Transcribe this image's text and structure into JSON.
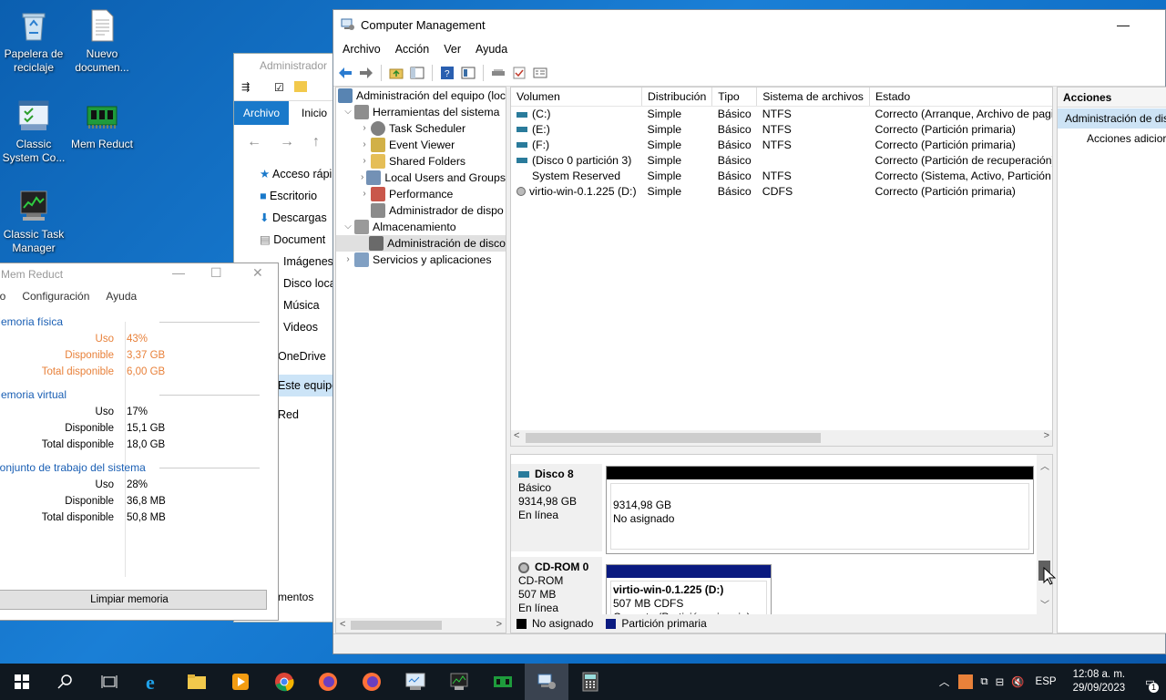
{
  "desktop": {
    "icons": [
      {
        "label_line1": "Papelera de",
        "label_line2": "reciclaje",
        "icon": "recycle-bin-icon"
      },
      {
        "label_line1": "Nuevo",
        "label_line2": "documen...",
        "icon": "document-icon"
      },
      {
        "label_line1": "Classic",
        "label_line2": "System Co...",
        "icon": "system-config-icon"
      },
      {
        "label_line1": "Mem Reduct",
        "label_line2": "",
        "icon": "memory-chip-icon"
      },
      {
        "label_line1": "Classic Task",
        "label_line2": "Manager",
        "icon": "task-manager-icon"
      }
    ]
  },
  "explorer": {
    "title": "Administrador",
    "tabs": {
      "archivo": "Archivo",
      "inicio": "Inicio"
    },
    "nav_items": [
      "Acceso rápi",
      "Escritorio",
      "Descargas",
      "Document",
      "Imágenes",
      "Disco loca",
      "Música",
      "Videos",
      "OneDrive",
      "Este equipo",
      "Red"
    ],
    "footer": "mentos"
  },
  "memreduct": {
    "title": "Mem Reduct",
    "menu": [
      "ivo",
      "Configuración",
      "Ayuda"
    ],
    "groups": [
      {
        "name": "Memoria física",
        "rows": [
          [
            "Uso",
            "43%"
          ],
          [
            "Disponible",
            "3,37 GB"
          ],
          [
            "Total disponible",
            "6,00 GB"
          ]
        ]
      },
      {
        "name": "Memoria virtual",
        "rows": [
          [
            "Uso",
            "17%"
          ],
          [
            "Disponible",
            "15,1 GB"
          ],
          [
            "Total disponible",
            "18,0 GB"
          ]
        ]
      },
      {
        "name": "Conjunto de trabajo del sistema",
        "rows": [
          [
            "Uso",
            "28%"
          ],
          [
            "Disponible",
            "36,8 MB"
          ],
          [
            "Total disponible",
            "50,8 MB"
          ]
        ]
      }
    ],
    "clean_button": "Limpiar memoria",
    "accent_color": "#e8813a"
  },
  "cm": {
    "title": "Computer Management",
    "menu": [
      "Archivo",
      "Acción",
      "Ver",
      "Ayuda"
    ],
    "tree": [
      {
        "label": "Administración del equipo (loc",
        "level": 0,
        "arrow": "",
        "icon": "computer-icon"
      },
      {
        "label": "Herramientas del sistema",
        "level": 1,
        "arrow": "v",
        "icon": "tools-icon"
      },
      {
        "label": "Task Scheduler",
        "level": 2,
        "arrow": ">",
        "icon": "clock-icon"
      },
      {
        "label": "Event Viewer",
        "level": 2,
        "arrow": ">",
        "icon": "event-viewer-icon"
      },
      {
        "label": "Shared Folders",
        "level": 2,
        "arrow": ">",
        "icon": "shared-folder-icon"
      },
      {
        "label": "Local Users and Groups",
        "level": 2,
        "arrow": ">",
        "icon": "users-icon"
      },
      {
        "label": "Performance",
        "level": 2,
        "arrow": ">",
        "icon": "performance-icon"
      },
      {
        "label": "Administrador de dispo",
        "level": 2,
        "arrow": "",
        "icon": "device-manager-icon"
      },
      {
        "label": "Almacenamiento",
        "level": 1,
        "arrow": "v",
        "icon": "storage-icon"
      },
      {
        "label": "Administración de disco",
        "level": 2,
        "arrow": "",
        "icon": "disk-management-icon",
        "selected": true
      },
      {
        "label": "Servicios y aplicaciones",
        "level": 1,
        "arrow": ">",
        "icon": "services-icon"
      }
    ],
    "volume_columns": [
      "Volumen",
      "Distribución",
      "Tipo",
      "Sistema de archivos",
      "Estado"
    ],
    "volumes": [
      [
        "(C:)",
        "Simple",
        "Básico",
        "NTFS",
        "Correcto (Arranque, Archivo de paginaci"
      ],
      [
        "(E:)",
        "Simple",
        "Básico",
        "NTFS",
        "Correcto (Partición primaria)"
      ],
      [
        "(F:)",
        "Simple",
        "Básico",
        "NTFS",
        "Correcto (Partición primaria)"
      ],
      [
        "(Disco 0 partición 3)",
        "Simple",
        "Básico",
        "",
        "Correcto (Partición de recuperación)"
      ],
      [
        "System Reserved",
        "Simple",
        "Básico",
        "NTFS",
        "Correcto (Sistema, Activo, Partición prim"
      ],
      [
        "virtio-win-0.1.225 (D:)",
        "Simple",
        "Básico",
        "CDFS",
        "Correcto (Partición primaria)"
      ]
    ],
    "disks": [
      {
        "name": "Disco 8",
        "type": "Básico",
        "size": "9314,98 GB",
        "status": "En línea",
        "part_size": "9314,98 GB",
        "part_status": "No asignado"
      },
      {
        "name": "CD-ROM 0",
        "type": "CD-ROM",
        "size": "507 MB",
        "status": "En línea",
        "part_name": "virtio-win-0.1.225  (D:)",
        "part_size": "507 MB CDFS",
        "part_status": "Correcto (Partición primaria)"
      }
    ],
    "legend": {
      "unallocated": "No asignado",
      "primary": "Partición primaria"
    },
    "actions": {
      "header": "Acciones",
      "section": "Administración de dis",
      "more": "Acciones adicior"
    }
  },
  "taskbar": {
    "lang": "ESP",
    "time": "12:08 a. m.",
    "date": "29/09/2023",
    "notif_count": "1"
  }
}
